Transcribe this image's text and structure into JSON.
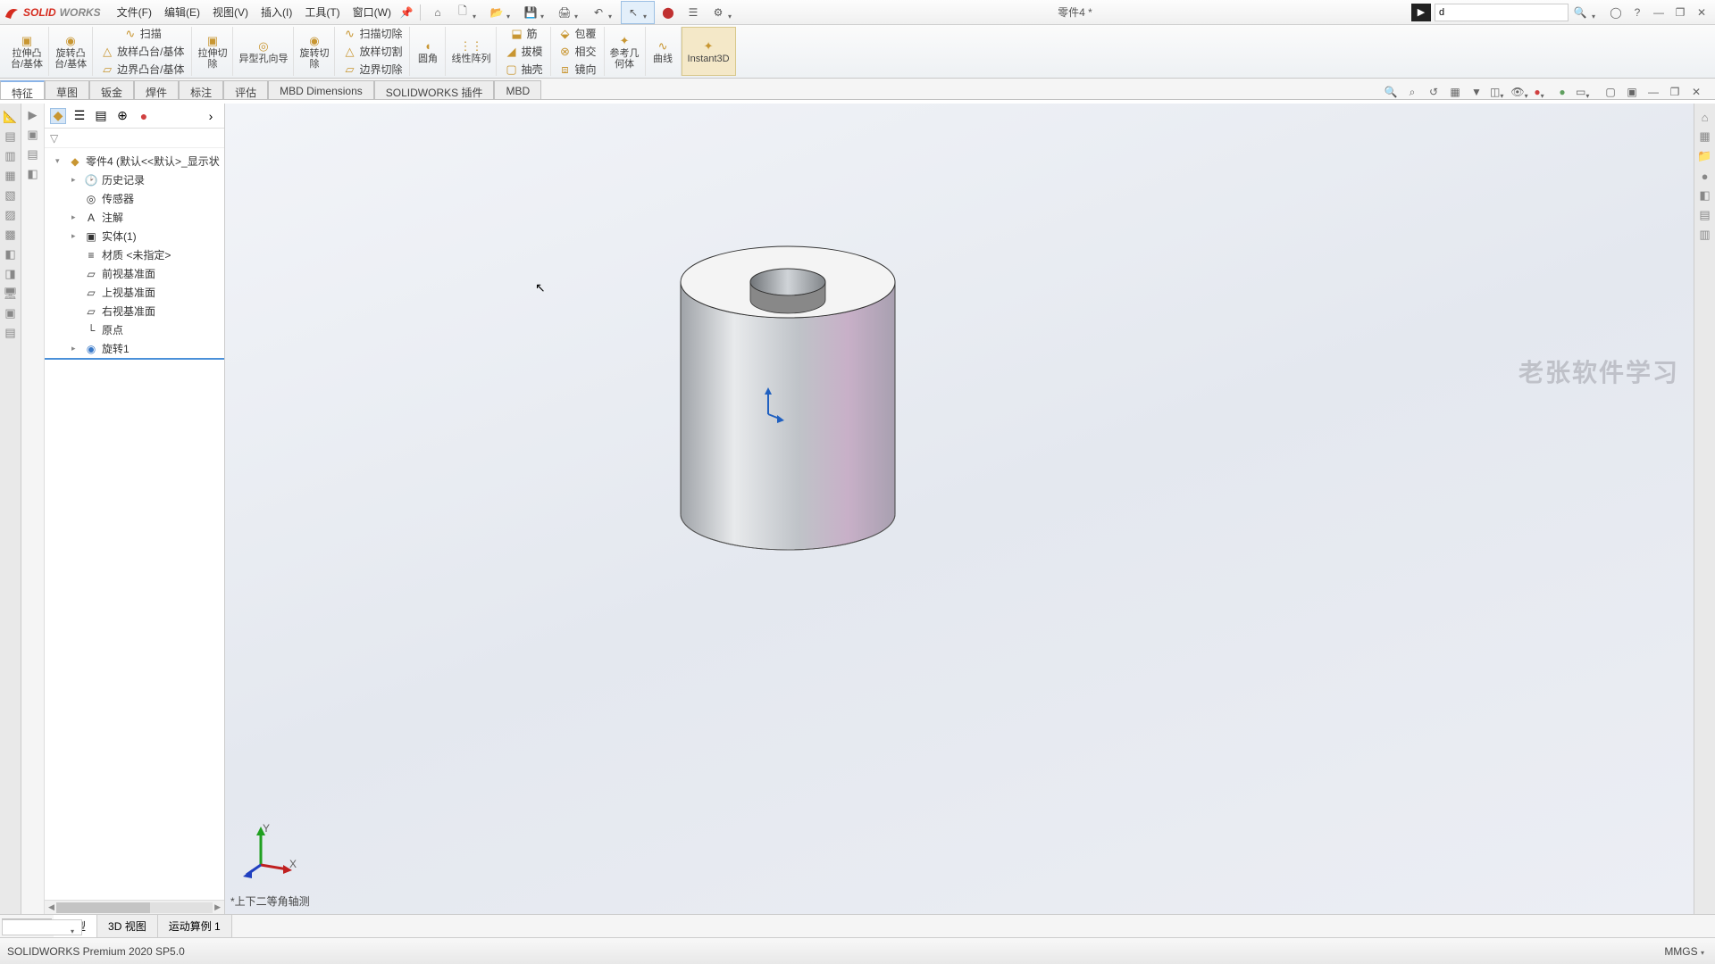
{
  "app": {
    "logo1": "SOLID",
    "logo2": "WORKS"
  },
  "menu": {
    "file": "文件(F)",
    "edit": "编辑(E)",
    "view": "视图(V)",
    "insert": "插入(I)",
    "tools": "工具(T)",
    "window": "窗口(W)"
  },
  "doc_title": "零件4 *",
  "search": {
    "placeholder": "",
    "value": "d"
  },
  "ribbon": {
    "extrude": "拉伸凸\n台/基体",
    "revolve": "旋转凸\n台/基体",
    "sweep": "扫描",
    "loft": "放样凸台/基体",
    "boundary": "边界凸台/基体",
    "excut": "拉伸切\n除",
    "hole": "异型孔向导",
    "revcut": "旋转切\n除",
    "sweepcut": "扫描切除",
    "loftcut": "放样切割",
    "boundcut": "边界切除",
    "fillet": "圆角",
    "pattern": "线性阵列",
    "rib": "筋",
    "draft": "拔模",
    "shell": "抽壳",
    "wrap": "包覆",
    "intersect": "相交",
    "mirror": "镜向",
    "refgeo": "参考几\n何体",
    "curves": "曲线",
    "instant": "Instant3D"
  },
  "tabs": {
    "feature": "特征",
    "sketch": "草图",
    "sheetmetal": "钣金",
    "weldment": "焊件",
    "annotate": "标注",
    "evaluate": "评估",
    "mbddim": "MBD Dimensions",
    "addins": "SOLIDWORKS 插件",
    "mbd": "MBD"
  },
  "tree": {
    "root": "零件4  (默认<<默认>_显示状",
    "history": "历史记录",
    "sensors": "传感器",
    "annotations": "注解",
    "solid": "实体(1)",
    "material": "材质 <未指定>",
    "front": "前视基准面",
    "top": "上视基准面",
    "right": "右视基准面",
    "origin": "原点",
    "rev1": "旋转1"
  },
  "canvas": {
    "viewname": "*上下二等角轴测",
    "watermark": "老张软件学习"
  },
  "bottom": {
    "model": "模型",
    "view3d": "3D 视图",
    "motion": "运动算例 1"
  },
  "status": {
    "left": "SOLIDWORKS Premium 2020 SP5.0",
    "units": "MMGS"
  }
}
